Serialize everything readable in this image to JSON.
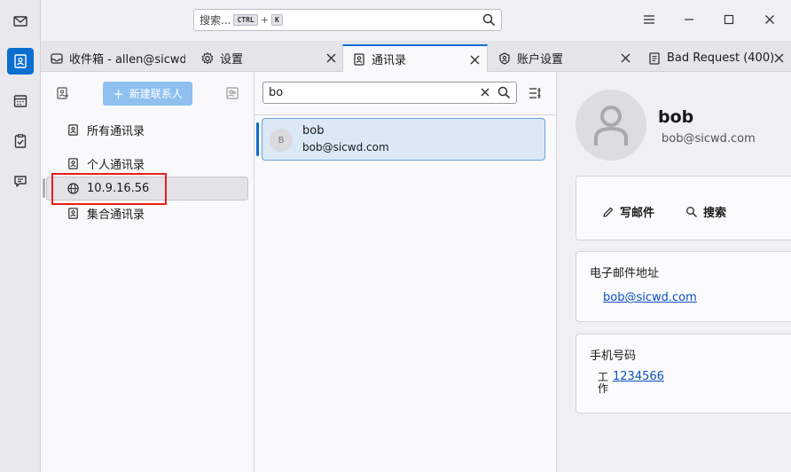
{
  "titlebar": {
    "search_placeholder": "搜索...",
    "shortcut_ctrl": "CTRL",
    "shortcut_plus": "+",
    "shortcut_key": "K"
  },
  "tabs": [
    {
      "label": "收件箱 - allen@sicwd.",
      "icon": "inbox-icon"
    },
    {
      "label": "设置",
      "icon": "gear-icon"
    },
    {
      "label": "通讯录",
      "icon": "address-book-icon",
      "active": true
    },
    {
      "label": "账户设置",
      "icon": "account-icon"
    },
    {
      "label": "Bad Request (400)",
      "icon": "document-icon"
    }
  ],
  "books": {
    "new_contact_label": "新建联系人",
    "items": [
      {
        "label": "所有通讯录"
      },
      {
        "label": "个人通讯录"
      },
      {
        "label": "10.9.16.56",
        "selected": true
      },
      {
        "label": "集合通讯录"
      }
    ]
  },
  "contacts": {
    "search_value": "bo",
    "list": [
      {
        "initial": "B",
        "name": "bob",
        "email": "bob@sicwd.com"
      }
    ]
  },
  "details": {
    "name": "bob",
    "email": "bob@sicwd.com",
    "write_mail": "写邮件",
    "search": "搜索",
    "email_section_title": "电子邮件地址",
    "email_link": "bob@sicwd.com",
    "phone_section_title": "手机号码",
    "phone_type": "工作",
    "phone_number": "1234566"
  },
  "colors": {
    "accent": "#0b6fd0",
    "highlight_box": "#e81d1d"
  }
}
